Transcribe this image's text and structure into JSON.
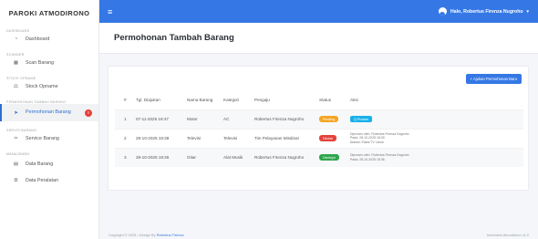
{
  "sidebar": {
    "brand": "PAROKI ATMODIRONO",
    "sections": [
      {
        "title": "DASHBOARD",
        "items": [
          {
            "label": "Dashboard",
            "icon": "gauge-icon"
          }
        ]
      },
      {
        "title": "SCANNER",
        "items": [
          {
            "label": "Scan Barang",
            "icon": "barcode-icon"
          }
        ]
      },
      {
        "title": "STOCK OPNAME",
        "items": [
          {
            "label": "Stock Opname",
            "icon": "scale-icon"
          }
        ]
      },
      {
        "title": "PERMOHONAN TAMBAH BARANG",
        "items": [
          {
            "label": "Permohonan Barang",
            "icon": "cursor-icon",
            "badge": "!"
          }
        ]
      },
      {
        "title": "SERVIS BARANG",
        "items": [
          {
            "label": "Service Barang",
            "icon": "tools-icon"
          }
        ]
      },
      {
        "title": "MANAJEMEN",
        "items": [
          {
            "label": "Data Barang",
            "icon": "boxes-icon"
          },
          {
            "label": "Data Peralatan",
            "icon": "gear-icon"
          }
        ]
      }
    ]
  },
  "topbar": {
    "menu_icon": "hamburger-icon",
    "user": "Halo, Robertus Firenza Nugroho"
  },
  "page": {
    "title": "Permohonan Tambah Barang",
    "add_button": "+ Ajukan Permohonan Baru"
  },
  "table": {
    "headers": [
      "#",
      "Tgl. Diajukan",
      "Nama Barang",
      "Kategori",
      "Pengaju",
      "Status",
      "Aksi"
    ],
    "rows": [
      {
        "no": "1",
        "date": "07-11-2025 18:47",
        "name": "Motor",
        "category": "AC",
        "requester": "Robertus Firenza Nugroho",
        "status": "Pending",
        "status_type": "pending",
        "action_button": "Q Proses",
        "note": ""
      },
      {
        "no": "2",
        "date": "28-10-2025 18:38",
        "name": "Televisi",
        "category": "Televisi",
        "requester": "Tim Pelayanan Misdinar",
        "status": "Ditolak",
        "status_type": "ditolak",
        "action_button": "",
        "note": "Diproses oleh: Robertus Firenza Nugroho\nPada: 28-10-2025 18:39\nAlasan: Pakai TV Lama"
      },
      {
        "no": "3",
        "date": "28-10-2025 18:36",
        "name": "Gitar",
        "category": "Alat Musik",
        "requester": "Robertus Firenza Nugroho",
        "status": "Disetujui",
        "status_type": "disetujui",
        "action_button": "",
        "note": "Diproses oleh: Robertus Firenza Nugroho\nPada: 28-10-2025 18:36"
      }
    ]
  },
  "footer": {
    "copyright": "Copyright © 2025",
    "design_by": " • Design By ",
    "author": "Robertus Firenza",
    "version": "Inventaris Atmodirono v1.0"
  },
  "colors": {
    "primary": "#3578e5",
    "pending": "#f5a623",
    "ditolak": "#e5413a",
    "disetujui": "#2ea64b",
    "proses": "#1ab0e8"
  }
}
